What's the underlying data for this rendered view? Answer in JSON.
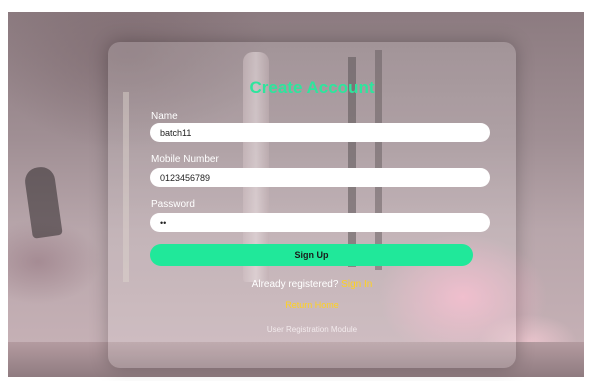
{
  "colors": {
    "accent_green": "#2ee59d",
    "button_green": "#20e89a",
    "link_yellow": "#ffd21f"
  },
  "form": {
    "title": "Create Account",
    "name_label": "Name",
    "name_value": "batch11",
    "mobile_label": "Mobile Number",
    "mobile_value": "0123456789",
    "password_label": "Password",
    "password_value": "••",
    "signup_label": "Sign Up",
    "already_text": "Already registered?",
    "signin_link": "Sign In",
    "return_link": "Return Home",
    "module_text": "User Registration Module"
  }
}
